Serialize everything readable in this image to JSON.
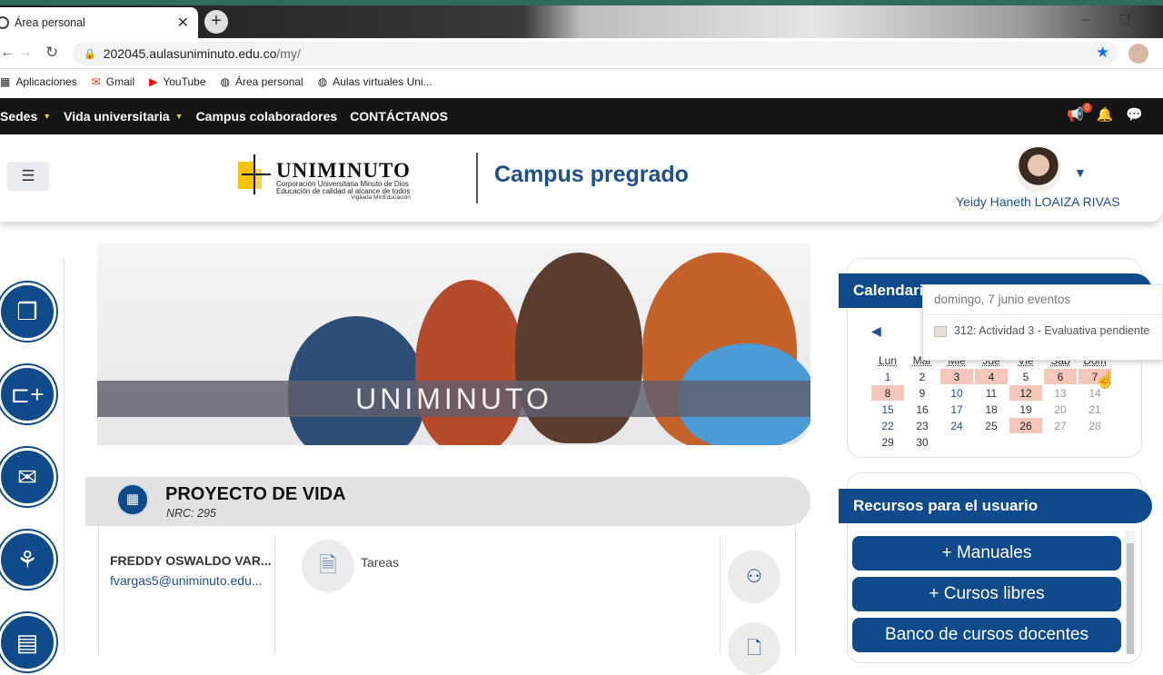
{
  "browser": {
    "tab_title": "Área personal",
    "url_host": "202045.aulasuniminuto.edu.co",
    "url_path": "/my/",
    "bookmarks": [
      {
        "label": "Aplicaciones",
        "icon": "apps-grid-icon"
      },
      {
        "label": "Gmail",
        "icon": "gmail-icon"
      },
      {
        "label": "YouTube",
        "icon": "youtube-icon"
      },
      {
        "label": "Área personal",
        "icon": "globe-icon"
      },
      {
        "label": "Aulas virtuales Uni...",
        "icon": "globe-icon"
      }
    ]
  },
  "topnav": {
    "items": [
      {
        "label": "Sedes",
        "has_caret": true
      },
      {
        "label": "Vida universitaria",
        "has_caret": true
      },
      {
        "label": "Campus colaboradores",
        "has_caret": false
      },
      {
        "label": "CONTÁCTANOS",
        "has_caret": false
      }
    ],
    "notification_count": "0"
  },
  "header": {
    "logo_name": "UNIMINUTO",
    "logo_line1": "Corporación Universitaria Minuto de Dios",
    "logo_line2": "Educación de calidad al alcance de todos",
    "logo_line3": "Vigilada MinEducación",
    "campus_title": "Campus pregrado",
    "user_name": "Yeidy Haneth LOAIZA RIVAS"
  },
  "banner": {
    "caption": "UNIMINUTO"
  },
  "course": {
    "title": "PROYECTO DE VIDA",
    "nrc": "NRC: 295",
    "teacher_name": "FREDDY OSWALDO VAR...",
    "teacher_email": "fvargas5@uniminuto.edu...",
    "activity_label": "Tareas"
  },
  "calendar": {
    "title": "Calendario",
    "weekdays": [
      "Lun",
      "Mar",
      "Mié",
      "Jue",
      "Vie",
      "Sáb",
      "Dom"
    ],
    "weeks": [
      [
        "1",
        "2",
        "3",
        "4",
        "5",
        "6",
        "7"
      ],
      [
        "8",
        "9",
        "10",
        "11",
        "12",
        "13",
        "14"
      ],
      [
        "15",
        "16",
        "17",
        "18",
        "19",
        "20",
        "21"
      ],
      [
        "22",
        "23",
        "24",
        "25",
        "26",
        "27",
        "28"
      ],
      [
        "29",
        "30",
        "",
        "",
        "",
        "",
        ""
      ]
    ],
    "event_days": [
      "3",
      "4",
      "6",
      "7",
      "8",
      "12",
      "26"
    ],
    "popover_title": "domingo, 7 junio eventos",
    "popover_event": "312: Actividad 3 - Evaluativa pendiente"
  },
  "resources": {
    "title": "Recursos para el usuario",
    "buttons": [
      "+ Manuales",
      "+ Cursos libres",
      "Banco de cursos docentes"
    ]
  },
  "colors": {
    "brand_blue": "#0f4a8a",
    "event_day": "#f4c7ba",
    "topnav_bg": "#151515"
  }
}
